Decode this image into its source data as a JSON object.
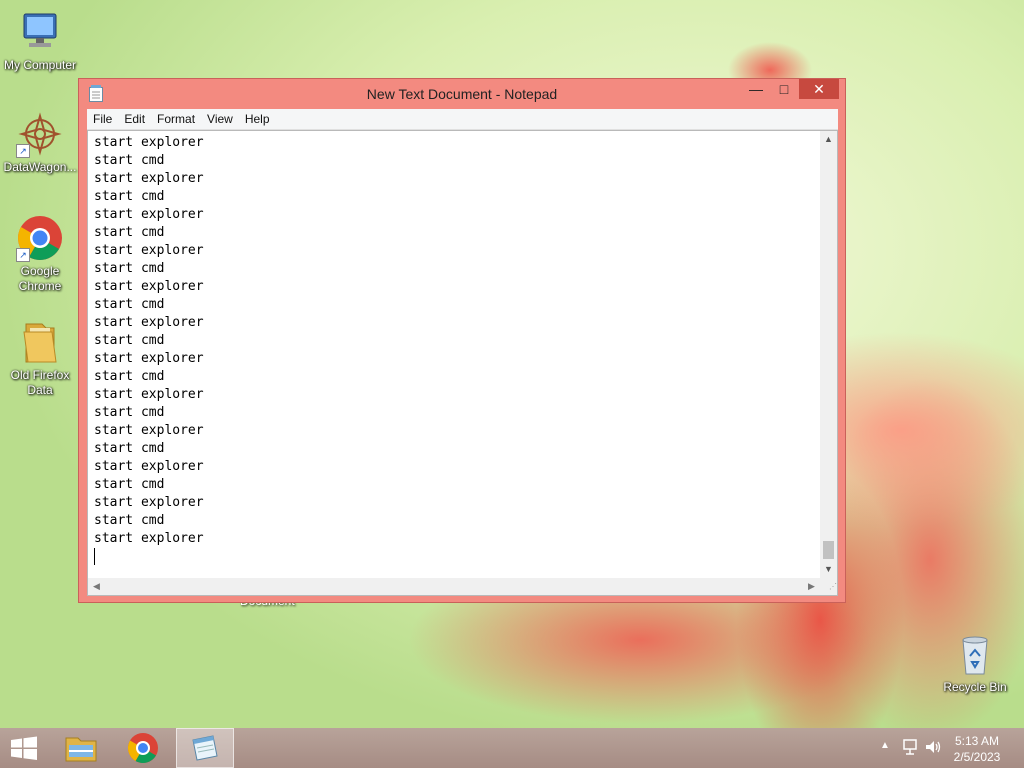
{
  "desktop": {
    "icons": [
      {
        "label": "My Computer"
      },
      {
        "label": "DataWagon..."
      },
      {
        "label": "Google Chrome"
      },
      {
        "label": "Old Firefox Data"
      },
      {
        "label": "Recycle Bin"
      }
    ],
    "hidden_label": "Document"
  },
  "window": {
    "title": "New Text Document - Notepad",
    "controls": {
      "minimize": "—",
      "maximize": "□",
      "close": "✕"
    },
    "menu": [
      "File",
      "Edit",
      "Format",
      "View",
      "Help"
    ],
    "content": "start explorer\nstart cmd\nstart explorer\nstart cmd\nstart explorer\nstart cmd\nstart explorer\nstart cmd\nstart explorer\nstart cmd\nstart explorer\nstart cmd\nstart explorer\nstart cmd\nstart explorer\nstart cmd\nstart explorer\nstart cmd\nstart explorer\nstart cmd\nstart explorer\nstart cmd\nstart explorer\n"
  },
  "taskbar": {
    "items": [
      "start-button",
      "file-explorer",
      "google-chrome",
      "notepad"
    ],
    "active": "notepad"
  },
  "tray": {
    "time": "5:13 AM",
    "date": "2/5/2023",
    "icons": [
      "show-hidden-icons",
      "network-icon",
      "volume-icon"
    ]
  },
  "colors": {
    "window_frame": "#f38a80",
    "close_button": "#c7493f",
    "taskbar": "#a68c84"
  }
}
